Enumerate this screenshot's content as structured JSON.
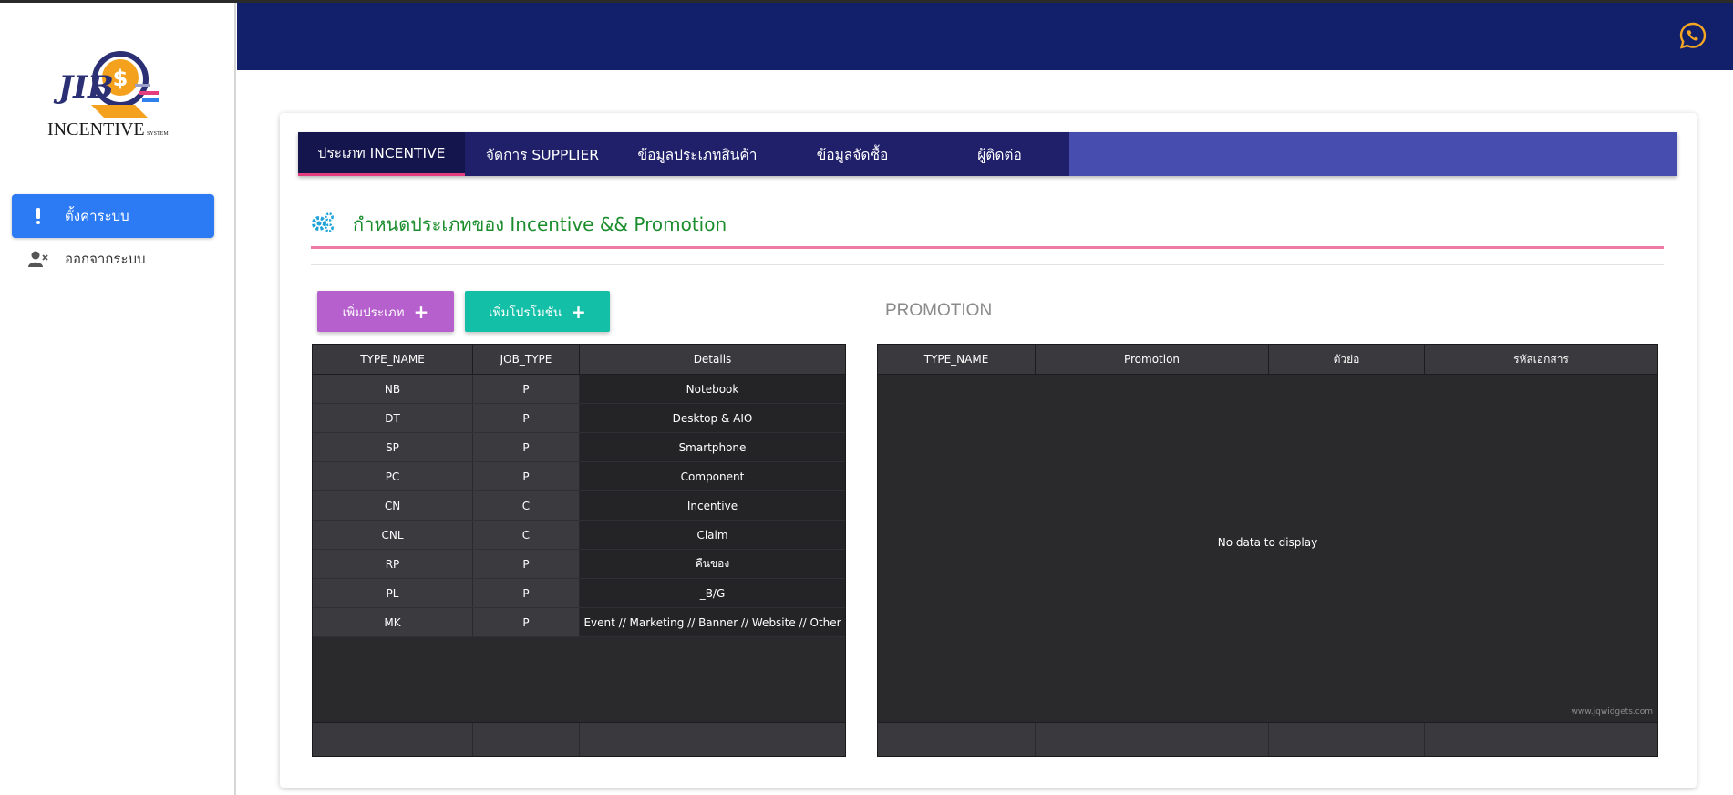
{
  "sidebar": {
    "logo": {
      "brand": "JIB",
      "subtitle": "INCENTIVE",
      "tag": "SYSTEM"
    },
    "items": [
      {
        "label": "ตั้งค่าระบบ",
        "icon": "exclamation-icon",
        "active": true
      },
      {
        "label": "ออกจากระบบ",
        "icon": "user-remove-icon",
        "active": false
      }
    ]
  },
  "header": {
    "icon": "whatsapp-icon",
    "accent": "#121f6a"
  },
  "tabs": [
    {
      "label": "ประเภท INCENTIVE",
      "active": true
    },
    {
      "label": "จัดการ SUPPLIER",
      "active": false
    },
    {
      "label": "ข้อมูลประเภทสินค้า",
      "active": false
    },
    {
      "label": "ข้อมูลจัดซื้อ",
      "active": false
    },
    {
      "label": "ผู้ติดต่อ",
      "active": false
    }
  ],
  "section": {
    "icon": "gears-icon",
    "title": "กำหนดประเภทของ Incentive && Promotion"
  },
  "buttons": {
    "add_type": "เพิ่มประเภท",
    "add_promo": "เพิ่มโปรโมชัน"
  },
  "promotion_heading": "PROMOTION",
  "type_grid": {
    "columns": [
      "TYPE_NAME",
      "JOB_TYPE",
      "Details"
    ],
    "rows": [
      [
        "NB",
        "P",
        "Notebook"
      ],
      [
        "DT",
        "P",
        "Desktop & AIO"
      ],
      [
        "SP",
        "P",
        "Smartphone"
      ],
      [
        "PC",
        "P",
        "Component"
      ],
      [
        "CN",
        "C",
        "Incentive"
      ],
      [
        "CNL",
        "C",
        "Claim"
      ],
      [
        "RP",
        "P",
        "คืนของ"
      ],
      [
        "PL",
        "P",
        "_B/G"
      ],
      [
        "MK",
        "P",
        "Event // Marketing // Banner // Website // Other"
      ]
    ]
  },
  "promo_grid": {
    "columns": [
      "TYPE_NAME",
      "Promotion",
      "ตัวย่อ",
      "รหัสเอกสาร"
    ],
    "empty_text": "No data to display",
    "watermark": "www.jqwidgets.com"
  }
}
